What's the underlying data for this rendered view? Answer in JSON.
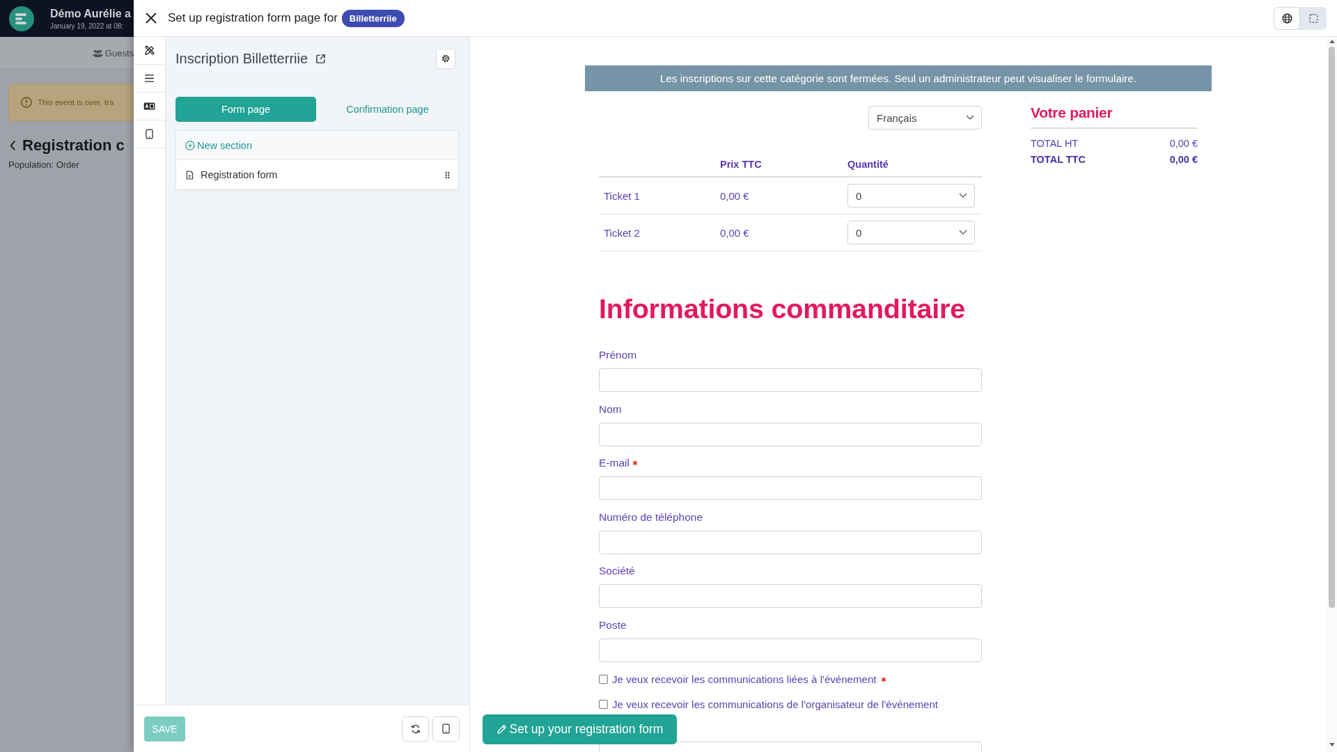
{
  "background_page": {
    "event_title": "Démo Aurélie a",
    "event_date": "January 19, 2022 at 08:",
    "tabs": [
      {
        "label": "Guests"
      }
    ],
    "alert": "This event is over, tra",
    "page_title": "Registration c",
    "subtitle": "Population: Order"
  },
  "dialog": {
    "title": "Set up registration form page for",
    "badge": "Billetterriie",
    "view_modes": [
      {
        "kind": "globe",
        "selected": true
      },
      {
        "kind": "frame",
        "selected": false
      }
    ]
  },
  "rail": [
    {
      "kind": "design"
    },
    {
      "kind": "list"
    },
    {
      "kind": "card"
    },
    {
      "kind": "phone"
    }
  ],
  "editor": {
    "page_name": "Inscription Billetterriie",
    "tabs": [
      {
        "label": "Form page",
        "selected": true
      },
      {
        "label": "Confirmation page",
        "selected": false
      }
    ],
    "new_section": "New section",
    "sections": [
      {
        "label": "Registration form"
      }
    ],
    "save": {
      "label": "SAVE",
      "disabled": true
    },
    "tools": [
      {
        "kind": "refresh"
      },
      {
        "kind": "phone"
      }
    ]
  },
  "preview": {
    "notice": "Les inscriptions sur cette catégorie sont fermées. Seul un administrateur peut visualiser le formulaire.",
    "language": "Français",
    "table": {
      "columns": [
        "Prix TTC",
        "Quantité"
      ],
      "rows": [
        {
          "ticket": "Ticket 1",
          "price": "0,00 €",
          "quantity": "0"
        },
        {
          "ticket": "Ticket 2",
          "price": "0,00 €",
          "quantity": "0"
        }
      ]
    },
    "heading": "Informations commanditaire",
    "fields": [
      {
        "label": "Prénom",
        "required": false
      },
      {
        "label": "Nom",
        "required": false
      },
      {
        "label": "E-mail",
        "required": true
      },
      {
        "label": "Numéro de téléphone",
        "required": false
      },
      {
        "label": "Société",
        "required": false
      },
      {
        "label": "Poste",
        "required": false
      }
    ],
    "consents": [
      {
        "label": "Je veux recevoir les communications liées à l'événement",
        "required": true,
        "checked": false
      },
      {
        "label": "Je veux recevoir les communications de l'organisateur de l'événement",
        "required": false,
        "checked": false
      }
    ],
    "more_inputs": [
      {
        "kind": "text"
      }
    ],
    "cart": {
      "title": "Votre panier",
      "lines": [
        {
          "label": "TOTAL HT",
          "value": "0,00 €",
          "strong": false
        },
        {
          "label": "TOTAL TTC",
          "value": "0,00 €",
          "strong": true
        }
      ]
    }
  },
  "setup_button": "Set up your registration form"
}
